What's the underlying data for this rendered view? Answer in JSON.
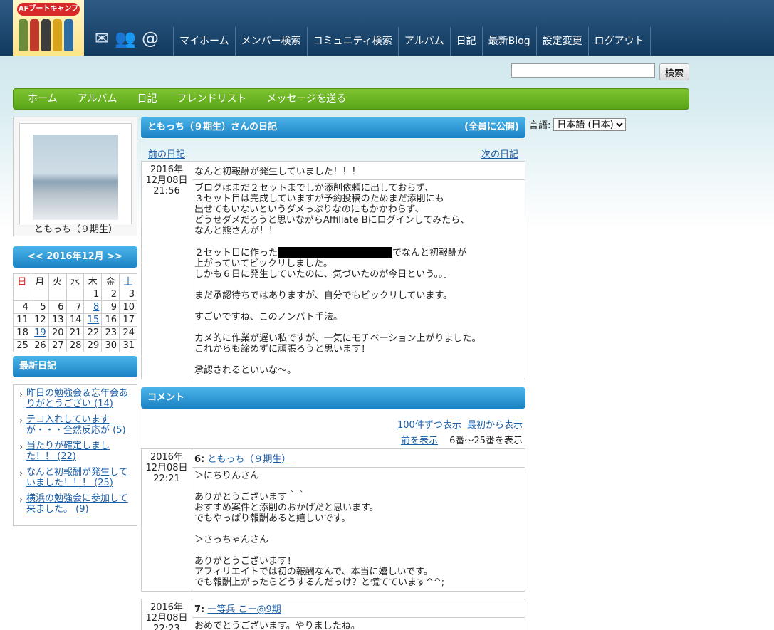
{
  "header": {
    "logo_text": "AFブートキャンプ",
    "nav": [
      "マイホーム",
      "メンバー検索",
      "コミュニティ検索",
      "アルバム",
      "日記",
      "最新Blog",
      "設定変更",
      "ログアウト"
    ]
  },
  "search": {
    "button": "検索",
    "value": ""
  },
  "gnav": [
    "ホーム",
    "アルバム",
    "日記",
    "フレンドリスト",
    "メッセージを送る"
  ],
  "profile": {
    "name": "ともっち（９期生）"
  },
  "calendar": {
    "title": "<< 2016年12月 >>",
    "weekdays": [
      "日",
      "月",
      "火",
      "水",
      "木",
      "金",
      "土"
    ],
    "rows": [
      [
        "",
        "",
        "",
        "",
        "1",
        "2",
        "3"
      ],
      [
        "4",
        "5",
        "6",
        "7",
        "8",
        "9",
        "10"
      ],
      [
        "11",
        "12",
        "13",
        "14",
        "15",
        "16",
        "17"
      ],
      [
        "18",
        "19",
        "20",
        "21",
        "22",
        "23",
        "24"
      ],
      [
        "25",
        "26",
        "27",
        "28",
        "29",
        "30",
        "31"
      ]
    ],
    "links": [
      "8",
      "15",
      "19"
    ]
  },
  "recent": {
    "title": "最新日記",
    "items": [
      "昨日の勉強会＆忘年会ありがとうござい (14)",
      "テコ入れしていますが・・・全然反応が (5)",
      "当たりが確定しました！！ (22)",
      "なんと初報酬が発生していました！！！ (25)",
      "横浜の勉強会に参加して来ました。 (9)"
    ]
  },
  "diary": {
    "header": "ともっち（９期生）さんの日記",
    "visibility": "(全員に公開)",
    "prev": "前の日記",
    "next": "次の日記",
    "date": "2016年\n12月08日\n21:56",
    "title": "なんと初報酬が発生していました！！！",
    "body1": "ブログはまだ２セットまでしか添削依頼に出しておらず、\n３セット目は完成していますが予約投稿のためまだ添削にも\n出せてもいないというダメっぷりなのにもかかわらず、\nどうせダメだろうと思いながらAffiliate Bにログインしてみたら、\nなんと熊さんが！！\n\n２セット目に作った",
    "body2": "でなんと初報酬が\n上がっていてビックリしました。\nしかも６日に発生していたのに、気づいたのが今日という。。。\n\nまだ承認待ちではありますが、自分でもビックリしています。\n\nすごいですね、このノンバト手法。\n\nカメ的に作業が遅い私ですが、一気にモチベーション上がりました。\nこれからも諦めずに頑張ろうと思います！\n\n承認されるといいな～。"
  },
  "comments": {
    "title": "コメント",
    "show100": "100件ずつ表示",
    "from_start": "最初から表示",
    "prev": "前を表示",
    "range": "6番～25番を表示",
    "items": [
      {
        "date": "2016年\n12月08日\n22:21",
        "num": "6:",
        "author": "ともっち（９期生）",
        "body": "＞にちりんさん\n\nありがとうございます＾＾\nおすすめ案件と添削のおかげだと思います。\nでもやっぱり報酬あると嬉しいです。\n\n＞さっちゃんさん\n\nありがとうございます！\nアフィリエイトでは初の報酬なんで、本当に嬉しいです。\nでも報酬上がったらどうするんだっけ？と慌てています^^;"
      },
      {
        "date": "2016年\n12月08日\n22:23",
        "num": "7:",
        "author": "一等兵 こー@9期",
        "body": "おめでとうございます。やりましたね。\nぎゅんぎゅん上がりますね"
      }
    ]
  },
  "language": {
    "label": "言語:",
    "selected": "日本語 (日本)"
  }
}
